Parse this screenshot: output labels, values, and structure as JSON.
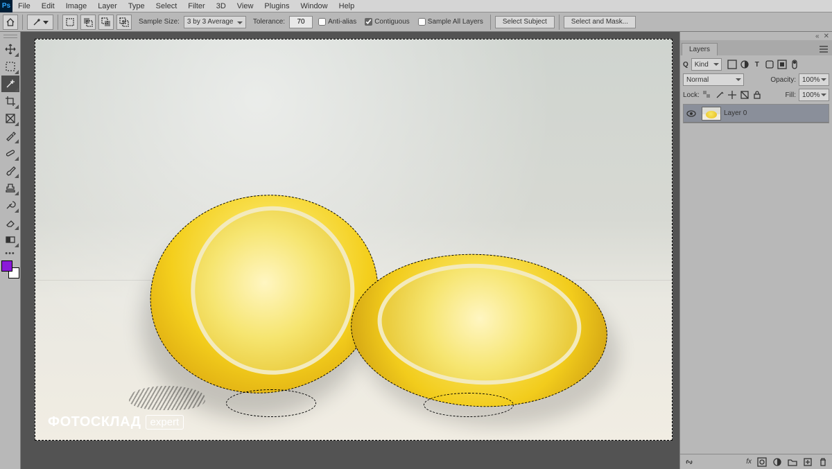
{
  "menu": {
    "items": [
      "File",
      "Edit",
      "Image",
      "Layer",
      "Type",
      "Select",
      "Filter",
      "3D",
      "View",
      "Plugins",
      "Window",
      "Help"
    ]
  },
  "options": {
    "sample_size_label": "Sample Size:",
    "sample_size_value": "3 by 3 Average",
    "tolerance_label": "Tolerance:",
    "tolerance_value": "70",
    "anti_alias": "Anti-alias",
    "contiguous": "Contiguous",
    "sample_all": "Sample All Layers",
    "select_subject": "Select Subject",
    "select_and_mask": "Select and Mask..."
  },
  "tools": [
    {
      "name": "move-tool"
    },
    {
      "name": "marquee-tool"
    },
    {
      "name": "magic-wand-tool",
      "active": true
    },
    {
      "name": "crop-tool"
    },
    {
      "name": "frame-tool"
    },
    {
      "name": "eyedropper-tool"
    },
    {
      "name": "healing-brush-tool"
    },
    {
      "name": "brush-tool"
    },
    {
      "name": "clone-stamp-tool"
    },
    {
      "name": "history-brush-tool"
    },
    {
      "name": "eraser-tool"
    },
    {
      "name": "gradient-tool"
    },
    {
      "name": "more-tools"
    }
  ],
  "swatch": {
    "fg": "#8b1ad8",
    "bg": "#ffffff"
  },
  "watermark": {
    "brand": "ФОТОСКЛАД",
    "tag": "expert"
  },
  "layers_panel": {
    "tab": "Layers",
    "filter_kind": "Kind",
    "blend_mode": "Normal",
    "opacity_label": "Opacity:",
    "opacity_value": "100%",
    "lock_label": "Lock:",
    "fill_label": "Fill:",
    "fill_value": "100%",
    "layers": [
      {
        "name": "Layer 0"
      }
    ],
    "footer_fx": "fx"
  },
  "icons": {
    "search": "Q"
  }
}
